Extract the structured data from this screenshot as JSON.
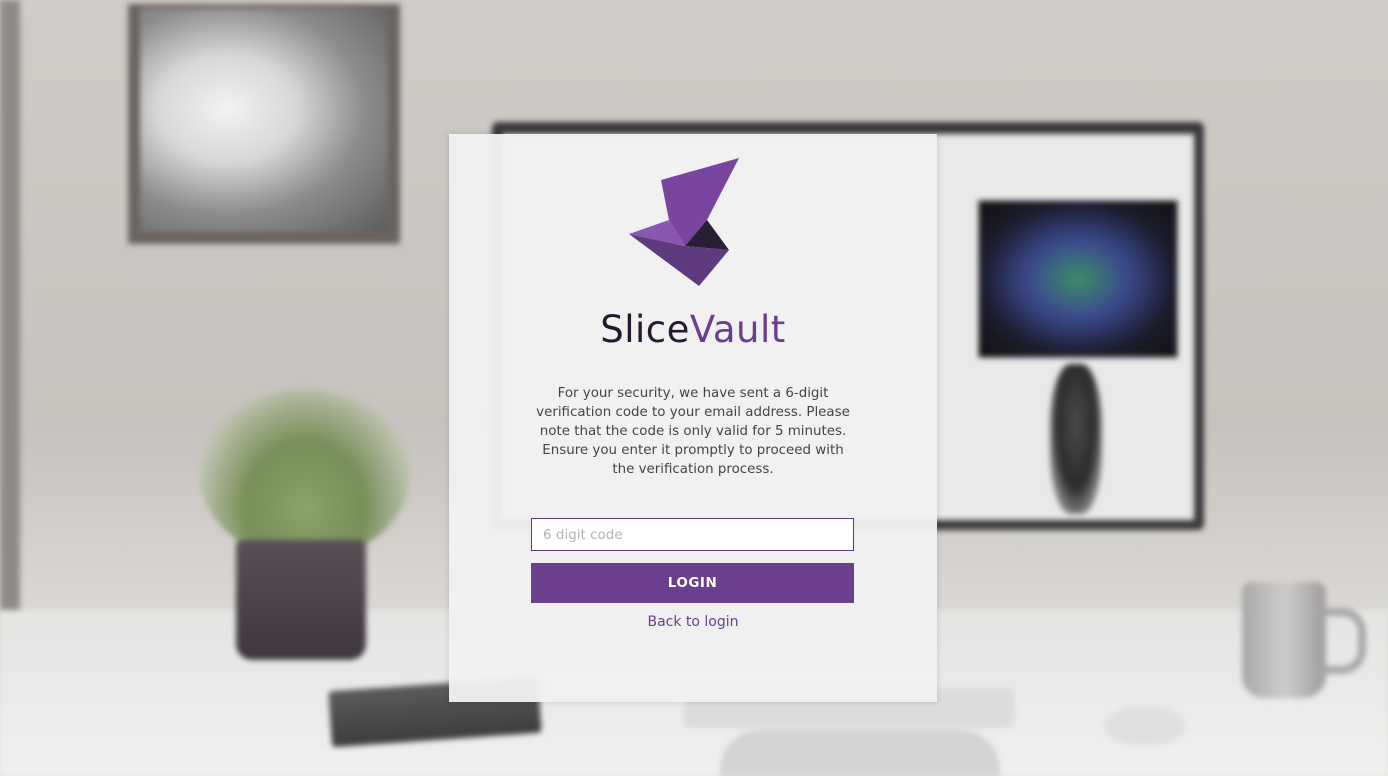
{
  "brand": {
    "name_part1": "Slice",
    "name_part2": "Vault",
    "logo_icon": "slicevault-logo-icon",
    "colors": {
      "primary": "#6b3e8e",
      "dark": "#24192e"
    }
  },
  "verification": {
    "message": "For your security, we have sent a 6-digit verification code to your email address. Please note that the code is only valid for 5 minutes. Ensure you enter it promptly to proceed with the verification process.",
    "code_input": {
      "placeholder": "6 digit code",
      "value": ""
    },
    "login_button_label": "LOGIN",
    "back_link_label": "Back to login"
  }
}
